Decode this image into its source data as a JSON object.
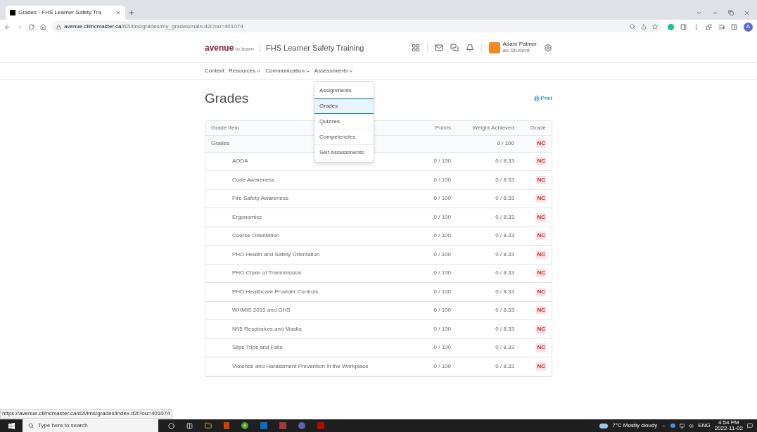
{
  "browser": {
    "tab_title": "Grades - FHS Learner Safety Tra",
    "url_host": "avenue.cllmcmaster.ca",
    "url_path": "/d2l/lms/grades/my_grades/main.d2l?ou=401074",
    "profile_initial": "A"
  },
  "header": {
    "logo": "avenue",
    "logo_tag": "to learn",
    "course": "FHS Learner Safety Training",
    "user_name": "Adam Palmer",
    "user_role": "as Student"
  },
  "nav": [
    {
      "label": "Content",
      "has_menu": false
    },
    {
      "label": "Resources",
      "has_menu": true
    },
    {
      "label": "Communication",
      "has_menu": true
    },
    {
      "label": "Assessments",
      "has_menu": true
    }
  ],
  "menu": [
    {
      "label": "Assignments",
      "selected": false
    },
    {
      "label": "Grades",
      "selected": true
    },
    {
      "label": "Quizzes",
      "selected": false
    },
    {
      "label": "Competencies",
      "selected": false
    },
    {
      "label": "Self Assessments",
      "selected": false
    }
  ],
  "page": {
    "title": "Grades",
    "print": "Print"
  },
  "table": {
    "columns": [
      "Grade Item",
      "Points",
      "Weight Achieved",
      "Grade"
    ],
    "rows": [
      {
        "kind": "category",
        "item": "Grades",
        "points": "",
        "weight": "0 / 100",
        "grade": "NC"
      },
      {
        "kind": "item",
        "item": "AODA",
        "points": "0 / 100",
        "weight": "0 / 8.33",
        "grade": "NC"
      },
      {
        "kind": "item",
        "item": "Code Awareness",
        "points": "0 / 100",
        "weight": "0 / 8.33",
        "grade": "NC"
      },
      {
        "kind": "item",
        "item": "Fire Safety Awareness",
        "points": "0 / 100",
        "weight": "0 / 8.33",
        "grade": "NC"
      },
      {
        "kind": "item",
        "item": "Ergonomics",
        "points": "0 / 100",
        "weight": "0 / 8.33",
        "grade": "NC"
      },
      {
        "kind": "item",
        "item": "Course Orientation",
        "points": "0 / 100",
        "weight": "0 / 8.33",
        "grade": "NC"
      },
      {
        "kind": "item",
        "item": "PHO Health and Safety Orientation",
        "points": "0 / 100",
        "weight": "0 / 8.33",
        "grade": "NC"
      },
      {
        "kind": "item",
        "item": "PHO Chain of Transmission",
        "points": "0 / 100",
        "weight": "0 / 8.33",
        "grade": "NC"
      },
      {
        "kind": "item",
        "item": "PHO Healthcare Provider Controls",
        "points": "0 / 100",
        "weight": "0 / 8.33",
        "grade": "NC"
      },
      {
        "kind": "item",
        "item": "WHMIS 2015 and GHS",
        "points": "0 / 100",
        "weight": "0 / 8.33",
        "grade": "NC"
      },
      {
        "kind": "item",
        "item": "N95 Respirators and Masks",
        "points": "0 / 100",
        "weight": "0 / 8.33",
        "grade": "NC"
      },
      {
        "kind": "item",
        "item": "Slips Trips and Falls",
        "points": "0 / 100",
        "weight": "0 / 8.33",
        "grade": "NC"
      },
      {
        "kind": "item",
        "item": "Violence and Harassment Prevention in the Workplace",
        "points": "0 / 100",
        "weight": "0 / 8.33",
        "grade": "NC"
      }
    ]
  },
  "status_url": "https://avenue.cllmcmaster.ca/d2l/lms/grades/index.d2l?ou=401074",
  "taskbar": {
    "search_placeholder": "Type here to search",
    "weather": "7°C Mostly cloudy",
    "language": "ENG",
    "time": "4:54 PM",
    "date": "2022-11-02"
  }
}
